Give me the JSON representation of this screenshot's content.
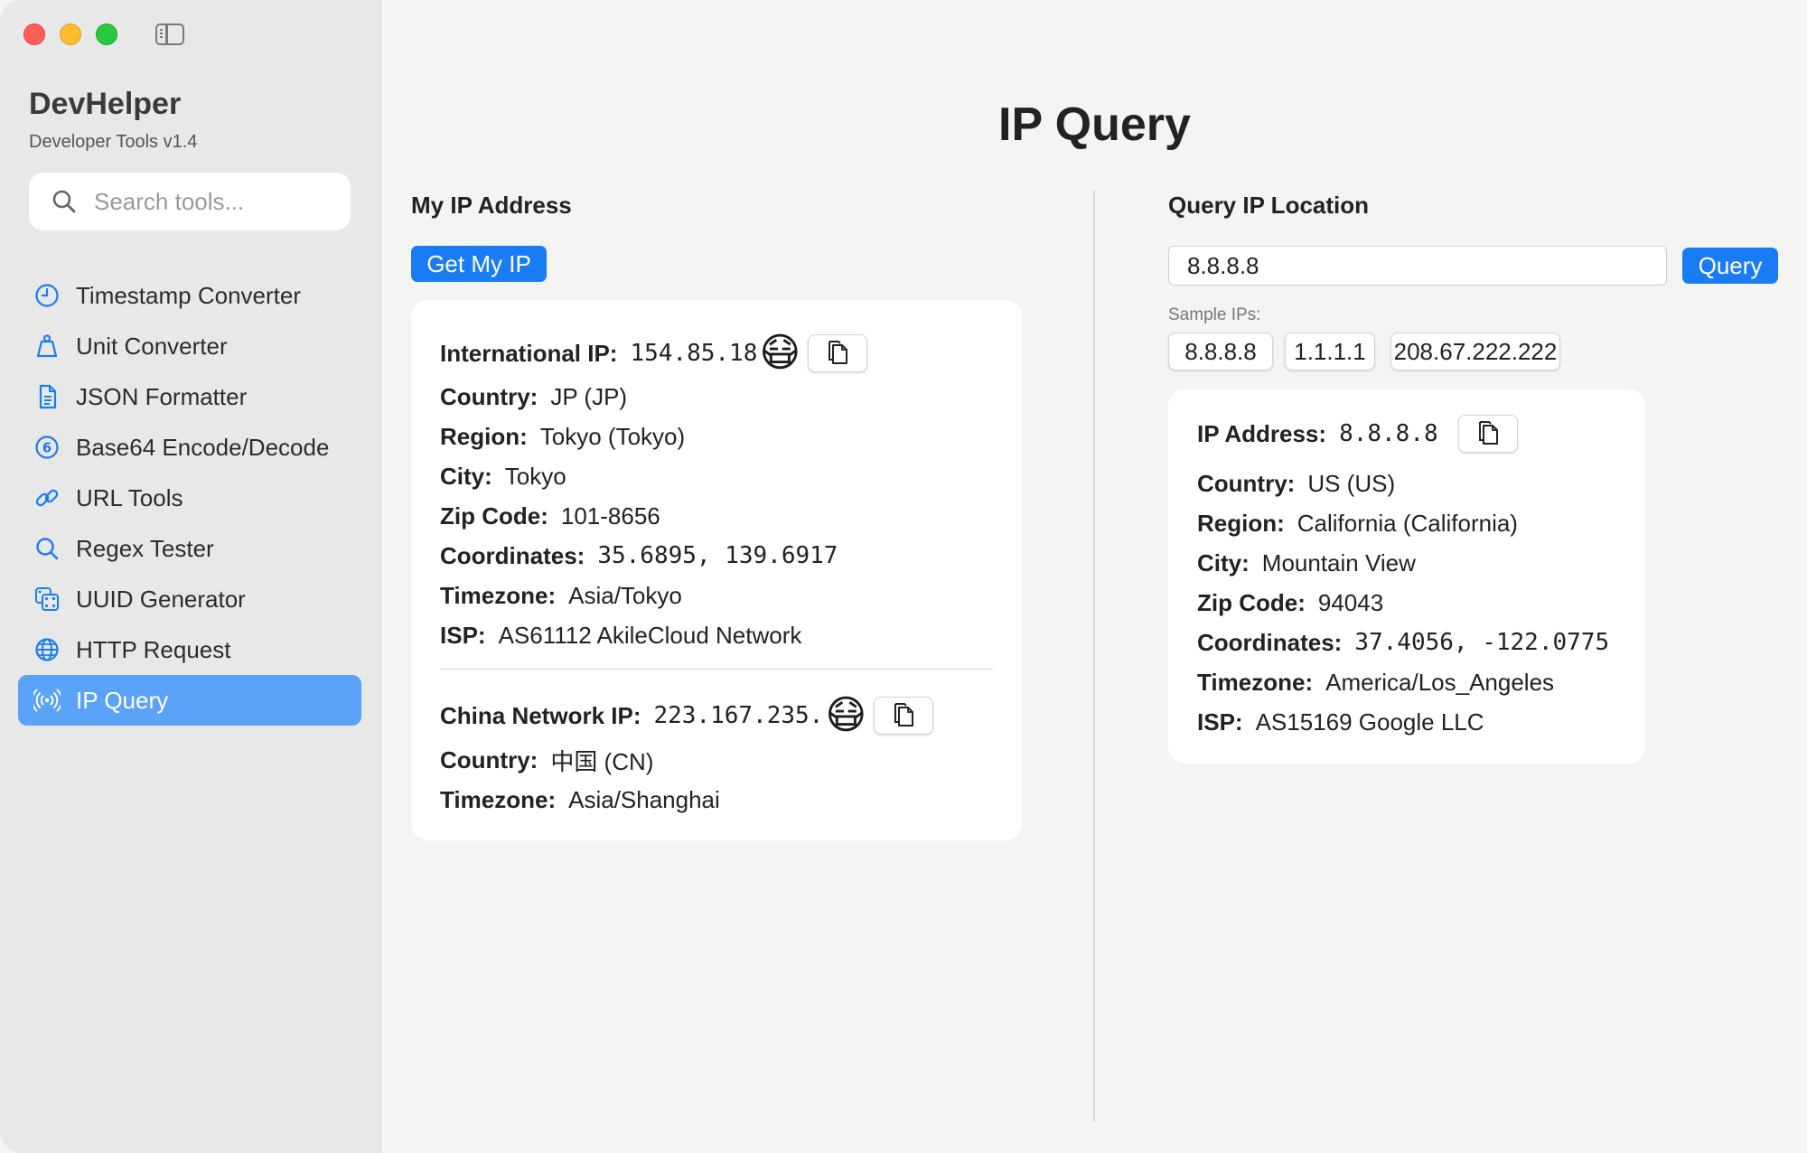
{
  "sidebar": {
    "app_title": "DevHelper",
    "app_subtitle": "Developer Tools v1.4",
    "search_placeholder": "Search tools...",
    "items": [
      {
        "label": "Timestamp Converter",
        "icon": "clock-icon"
      },
      {
        "label": "Unit Converter",
        "icon": "weight-icon"
      },
      {
        "label": "JSON Formatter",
        "icon": "document-icon"
      },
      {
        "label": "Base64 Encode/Decode",
        "icon": "number-six-circle-icon"
      },
      {
        "label": "URL Tools",
        "icon": "link-icon"
      },
      {
        "label": "Regex Tester",
        "icon": "magnifier-icon"
      },
      {
        "label": "UUID Generator",
        "icon": "dice-icon"
      },
      {
        "label": "HTTP Request",
        "icon": "globe-icon"
      },
      {
        "label": "IP Query",
        "icon": "broadcast-icon",
        "active": true
      }
    ]
  },
  "main": {
    "title": "IP Query",
    "my_ip": {
      "section_title": "My IP Address",
      "button_label": "Get My IP",
      "international": {
        "ip_label": "International IP:",
        "ip_value": "154.85.18",
        "emoji": "😷",
        "country_label": "Country:",
        "country": "JP (JP)",
        "region_label": "Region:",
        "region": "Tokyo (Tokyo)",
        "city_label": "City:",
        "city": "Tokyo",
        "zip_label": "Zip Code:",
        "zip": "101-8656",
        "coords_label": "Coordinates:",
        "coords": "35.6895, 139.6917",
        "timezone_label": "Timezone:",
        "timezone": "Asia/Tokyo",
        "isp_label": "ISP:",
        "isp": "AS61112 AkileCloud Network"
      },
      "china": {
        "ip_label": "China Network IP:",
        "ip_value": "223.167.235.",
        "emoji": "😷",
        "country_label": "Country:",
        "country": "中国 (CN)",
        "timezone_label": "Timezone:",
        "timezone": "Asia/Shanghai"
      }
    },
    "query": {
      "section_title": "Query IP Location",
      "input_value": "8.8.8.8",
      "button_label": "Query",
      "sample_label": "Sample IPs:",
      "samples": [
        "8.8.8.8",
        "1.1.1.1",
        "208.67.222.222"
      ],
      "result": {
        "ip_label": "IP Address:",
        "ip_value": "8.8.8.8",
        "country_label": "Country:",
        "country": "US (US)",
        "region_label": "Region:",
        "region": "California (California)",
        "city_label": "City:",
        "city": "Mountain View",
        "zip_label": "Zip Code:",
        "zip": "94043",
        "coords_label": "Coordinates:",
        "coords": "37.4056, -122.0775",
        "timezone_label": "Timezone:",
        "timezone": "America/Los_Angeles",
        "isp_label": "ISP:",
        "isp": "AS15169 Google LLC"
      }
    }
  },
  "colors": {
    "accent": "#1a7cf5",
    "active_item": "#5aa3f8",
    "sidebar_bg": "#e8e8e8",
    "main_bg": "#f4f4f3"
  }
}
